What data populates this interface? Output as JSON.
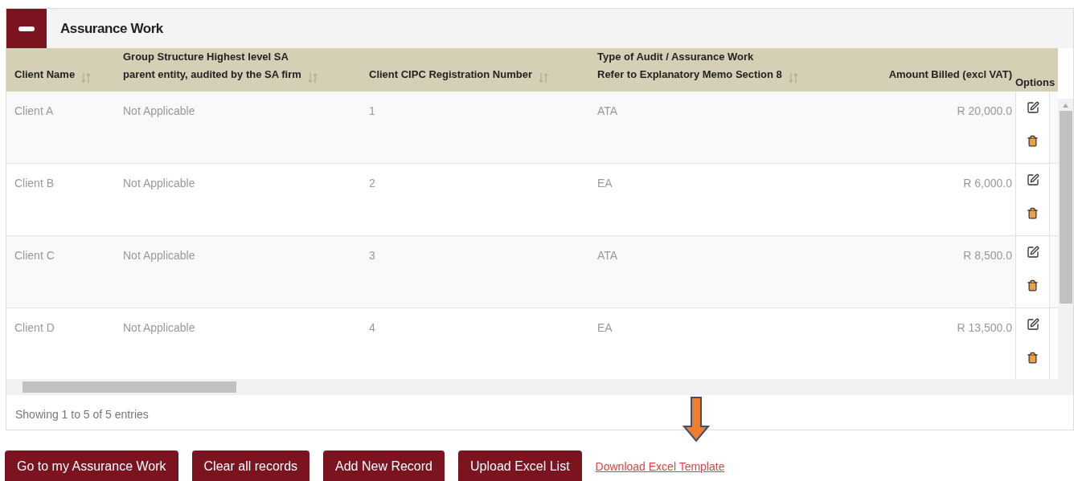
{
  "panel": {
    "title": "Assurance Work"
  },
  "table": {
    "columns": [
      {
        "label_lines": [
          "Client Name"
        ],
        "sortable": true
      },
      {
        "label_lines": [
          "Group Structure Highest level SA",
          "parent entity, audited by the SA firm"
        ],
        "sortable": true
      },
      {
        "label_lines": [
          "Client CIPC Registration Number"
        ],
        "sortable": true
      },
      {
        "label_lines": [
          "Type of Audit / Assurance Work",
          "Refer to Explanatory Memo Section 8"
        ],
        "sortable": true
      },
      {
        "label_lines": [
          "Amount Billed (excl VAT)"
        ],
        "sortable": false
      },
      {
        "label_lines": [
          "Options"
        ],
        "sortable": false
      }
    ],
    "rows": [
      {
        "cells": [
          "Client A",
          "Not Applicable",
          "1",
          "ATA",
          "R 20,000.0"
        ]
      },
      {
        "cells": [
          "Client B",
          "Not Applicable",
          "2",
          "EA",
          "R 6,000.0"
        ]
      },
      {
        "cells": [
          "Client C",
          "Not Applicable",
          "3",
          "ATA",
          "R 8,500.0"
        ]
      },
      {
        "cells": [
          "Client D",
          "Not Applicable",
          "4",
          "EA",
          "R 13,500.0"
        ]
      }
    ]
  },
  "footer_info": "Showing 1 to 5 of 5 entries",
  "buttons": [
    "Go to my Assurance Work",
    "Clear all records",
    "Add New Record",
    "Upload Excel List"
  ],
  "link": "Download Excel Template"
}
